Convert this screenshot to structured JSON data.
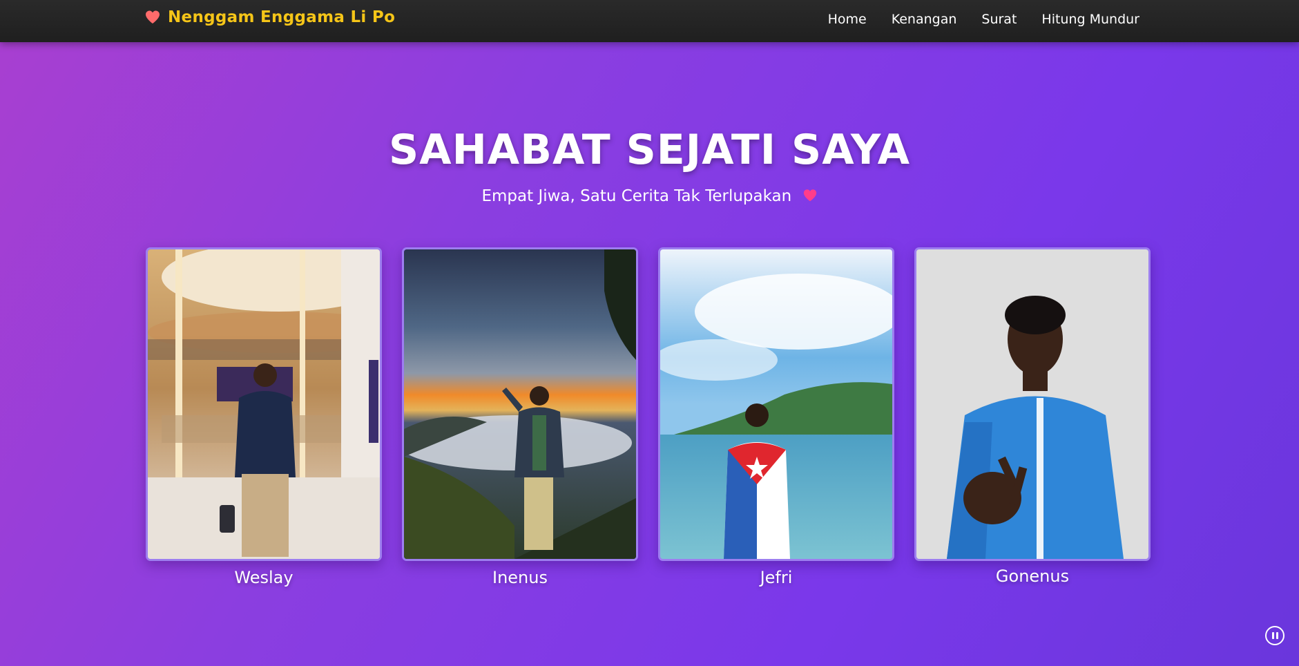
{
  "navbar": {
    "brand_icon": "heart-icon",
    "brand_title": "Nenggam Enggama Li Po",
    "brand_color": "#f5c518",
    "links": [
      {
        "label": "Home"
      },
      {
        "label": "Kenangan"
      },
      {
        "label": "Surat"
      },
      {
        "label": "Hitung Mundur"
      }
    ]
  },
  "hero": {
    "title": "SAHABAT SEJATI SAYA",
    "subtitle": "Empat Jiwa, Satu Cerita Tak Terlupakan",
    "subtitle_icon": "pink-heart-icon"
  },
  "friends": [
    {
      "name": "Weslay",
      "photo_icon": "photo-mall-portrait"
    },
    {
      "name": "Inenus",
      "photo_icon": "photo-sunset-mountain-portrait"
    },
    {
      "name": "Jefri",
      "photo_icon": "photo-lake-portrait"
    },
    {
      "name": "Gonenus",
      "photo_icon": "photo-blue-shirt-portrait"
    }
  ],
  "audio_control": {
    "icon": "pause-icon"
  },
  "colors": {
    "navbar_bg": "#222222",
    "background_start": "#a93fd0",
    "background_end": "#6a36dc",
    "card_border": "#9d7ef0"
  }
}
